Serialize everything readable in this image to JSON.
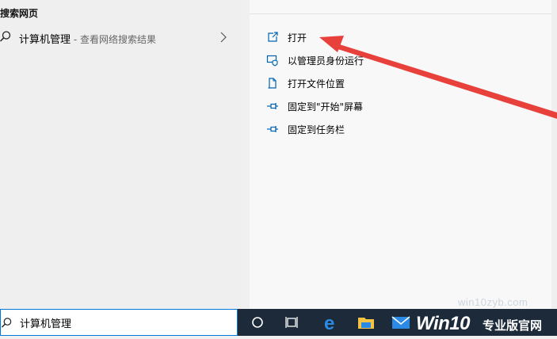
{
  "left": {
    "section_title": "搜索网页",
    "web_result": {
      "title": "计算机管理",
      "suffix": " - 查看网络搜索结果",
      "icon": "search-icon"
    }
  },
  "actions": [
    {
      "label": "打开",
      "icon": "open-icon"
    },
    {
      "label": "以管理员身份运行",
      "icon": "admin-shield-icon"
    },
    {
      "label": "打开文件位置",
      "icon": "file-location-icon"
    },
    {
      "label": "固定到\"开始\"屏幕",
      "icon": "pin-icon"
    },
    {
      "label": "固定到任务栏",
      "icon": "pin-icon"
    }
  ],
  "search": {
    "value": "计算机管理"
  },
  "taskbar": {
    "items": [
      "cortana-icon",
      "task-view-icon",
      "edge-icon",
      "file-explorer-icon",
      "mail-icon"
    ]
  },
  "watermark": {
    "url": "win10zyb.com",
    "brand": "Win10",
    "brand_cn": "专业版官网"
  },
  "colors": {
    "accent": "#0078d7",
    "arrow": "#e8413b",
    "taskbar": "#1c2a3a"
  }
}
